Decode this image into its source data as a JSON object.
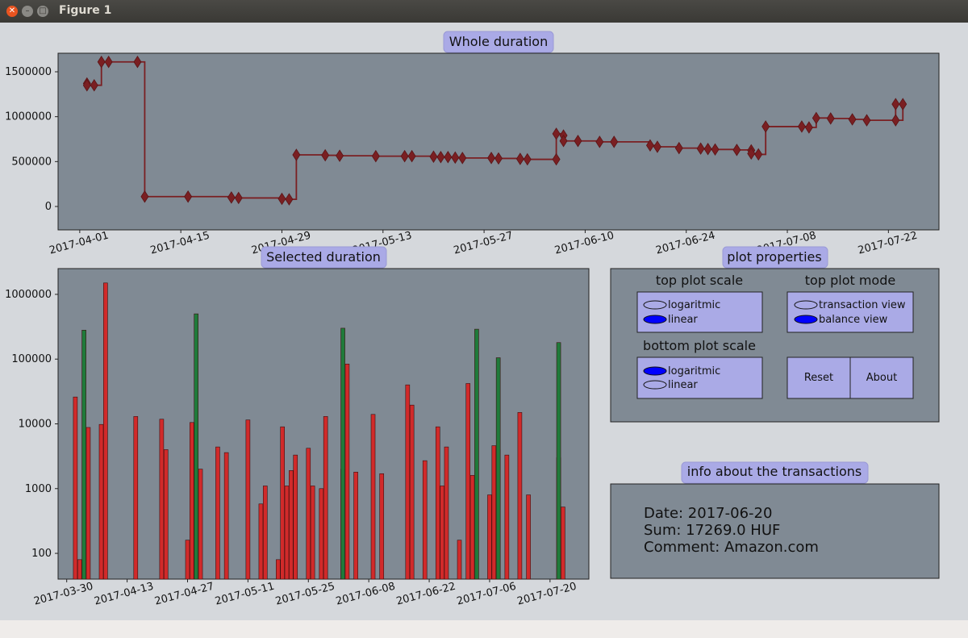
{
  "window": {
    "title": "Figure 1"
  },
  "top_chart": {
    "title": "Whole duration",
    "yticks": [
      0,
      500000,
      1000000,
      1500000
    ],
    "ytick_labels": [
      "0",
      "500000",
      "1000000",
      "1500000"
    ],
    "xtick_labels": [
      "2017-04-01",
      "2017-04-15",
      "2017-04-29",
      "2017-05-13",
      "2017-05-27",
      "2017-06-10",
      "2017-06-24",
      "2017-07-08",
      "2017-07-22"
    ]
  },
  "bottom_chart": {
    "title": "Selected duration",
    "ytick_labels": [
      "100",
      "1000",
      "10000",
      "100000",
      "1000000"
    ],
    "xtick_labels": [
      "2017-03-30",
      "2017-04-13",
      "2017-04-27",
      "2017-05-11",
      "2017-05-25",
      "2017-06-08",
      "2017-06-22",
      "2017-07-06",
      "2017-07-20"
    ]
  },
  "controls": {
    "title": "plot properties",
    "top_scale": {
      "label": "top plot scale",
      "options": [
        "logaritmic",
        "linear"
      ],
      "selected": "linear"
    },
    "top_mode": {
      "label": "top plot mode",
      "options": [
        "transaction view",
        "balance view"
      ],
      "selected": "balance view"
    },
    "bottom_scale": {
      "label": "bottom plot scale",
      "options": [
        "logaritmic",
        "linear"
      ],
      "selected": "logaritmic"
    },
    "reset_label": "Reset",
    "about_label": "About"
  },
  "info": {
    "title": "info about the transactions",
    "date_line": "Date: 2017-06-20",
    "sum_line": "Sum: 17269.0 HUF",
    "comment_line": "Comment: Amazon.com"
  },
  "colors": {
    "axes_bg": "#808a94",
    "line": "#7a1f22",
    "expense": "#d12a2a",
    "income": "#1f7a3a",
    "widget": "#aaaae6",
    "radio_on": "#0000ff"
  },
  "chart_data": [
    {
      "type": "line",
      "title": "Whole duration",
      "x_type": "date",
      "xlim": [
        "2017-03-29",
        "2017-07-29"
      ],
      "ylim": [
        0,
        1700000
      ],
      "grid": false,
      "marker": "diamond",
      "step": true,
      "points": [
        {
          "x": "2017-04-02",
          "y": 1370000
        },
        {
          "x": "2017-04-02",
          "y": 1350000
        },
        {
          "x": "2017-04-03",
          "y": 1350000
        },
        {
          "x": "2017-04-04",
          "y": 1610000
        },
        {
          "x": "2017-04-05",
          "y": 1610000
        },
        {
          "x": "2017-04-09",
          "y": 1610000
        },
        {
          "x": "2017-04-10",
          "y": 110000
        },
        {
          "x": "2017-04-16",
          "y": 110000
        },
        {
          "x": "2017-04-22",
          "y": 100000
        },
        {
          "x": "2017-04-23",
          "y": 95000
        },
        {
          "x": "2017-04-29",
          "y": 85000
        },
        {
          "x": "2017-04-30",
          "y": 80000
        },
        {
          "x": "2017-05-01",
          "y": 575000
        },
        {
          "x": "2017-05-05",
          "y": 570000
        },
        {
          "x": "2017-05-07",
          "y": 565000
        },
        {
          "x": "2017-05-12",
          "y": 560000
        },
        {
          "x": "2017-05-16",
          "y": 560000
        },
        {
          "x": "2017-05-17",
          "y": 560000
        },
        {
          "x": "2017-05-20",
          "y": 555000
        },
        {
          "x": "2017-05-21",
          "y": 550000
        },
        {
          "x": "2017-05-22",
          "y": 550000
        },
        {
          "x": "2017-05-23",
          "y": 545000
        },
        {
          "x": "2017-05-24",
          "y": 540000
        },
        {
          "x": "2017-05-28",
          "y": 540000
        },
        {
          "x": "2017-05-29",
          "y": 535000
        },
        {
          "x": "2017-06-01",
          "y": 530000
        },
        {
          "x": "2017-06-02",
          "y": 525000
        },
        {
          "x": "2017-06-06",
          "y": 525000
        },
        {
          "x": "2017-06-06",
          "y": 810000
        },
        {
          "x": "2017-06-07",
          "y": 790000
        },
        {
          "x": "2017-06-07",
          "y": 730000
        },
        {
          "x": "2017-06-09",
          "y": 730000
        },
        {
          "x": "2017-06-12",
          "y": 720000
        },
        {
          "x": "2017-06-14",
          "y": 720000
        },
        {
          "x": "2017-06-19",
          "y": 680000
        },
        {
          "x": "2017-06-20",
          "y": 665000
        },
        {
          "x": "2017-06-23",
          "y": 650000
        },
        {
          "x": "2017-06-26",
          "y": 645000
        },
        {
          "x": "2017-06-27",
          "y": 640000
        },
        {
          "x": "2017-06-28",
          "y": 635000
        },
        {
          "x": "2017-07-01",
          "y": 630000
        },
        {
          "x": "2017-07-03",
          "y": 625000
        },
        {
          "x": "2017-07-03",
          "y": 590000
        },
        {
          "x": "2017-07-04",
          "y": 580000
        },
        {
          "x": "2017-07-05",
          "y": 890000
        },
        {
          "x": "2017-07-10",
          "y": 890000
        },
        {
          "x": "2017-07-11",
          "y": 880000
        },
        {
          "x": "2017-07-12",
          "y": 985000
        },
        {
          "x": "2017-07-14",
          "y": 980000
        },
        {
          "x": "2017-07-17",
          "y": 970000
        },
        {
          "x": "2017-07-19",
          "y": 960000
        },
        {
          "x": "2017-07-23",
          "y": 1140000
        },
        {
          "x": "2017-07-23",
          "y": 960000
        },
        {
          "x": "2017-07-24",
          "y": 1140000
        }
      ]
    },
    {
      "type": "bar",
      "title": "Selected duration",
      "x_type": "date",
      "xlim": [
        "2017-03-28",
        "2017-07-29"
      ],
      "ylim": [
        40,
        2500000
      ],
      "yscale": "log",
      "grid": false,
      "series": [
        {
          "kind": "expense",
          "points": [
            {
              "x": "2017-04-01",
              "y": 26000
            },
            {
              "x": "2017-04-02",
              "y": 80
            },
            {
              "x": "2017-04-04",
              "y": 8800
            },
            {
              "x": "2017-04-07",
              "y": 9800
            },
            {
              "x": "2017-04-08",
              "y": 1500000
            },
            {
              "x": "2017-04-15",
              "y": 13000
            },
            {
              "x": "2017-04-21",
              "y": 11800
            },
            {
              "x": "2017-04-22",
              "y": 4000
            },
            {
              "x": "2017-04-27",
              "y": 160
            },
            {
              "x": "2017-04-28",
              "y": 10500
            },
            {
              "x": "2017-04-30",
              "y": 2000
            },
            {
              "x": "2017-05-04",
              "y": 4400
            },
            {
              "x": "2017-05-06",
              "y": 3600
            },
            {
              "x": "2017-05-11",
              "y": 11500
            },
            {
              "x": "2017-05-14",
              "y": 580
            },
            {
              "x": "2017-05-15",
              "y": 1100
            },
            {
              "x": "2017-05-18",
              "y": 80
            },
            {
              "x": "2017-05-19",
              "y": 9000
            },
            {
              "x": "2017-05-20",
              "y": 1100
            },
            {
              "x": "2017-05-21",
              "y": 1900
            },
            {
              "x": "2017-05-22",
              "y": 3300
            },
            {
              "x": "2017-05-25",
              "y": 4200
            },
            {
              "x": "2017-05-26",
              "y": 1100
            },
            {
              "x": "2017-05-28",
              "y": 1000
            },
            {
              "x": "2017-05-29",
              "y": 13000
            },
            {
              "x": "2017-06-02",
              "y": 2000
            },
            {
              "x": "2017-06-03",
              "y": 84000
            },
            {
              "x": "2017-06-05",
              "y": 1800
            },
            {
              "x": "2017-06-09",
              "y": 14000
            },
            {
              "x": "2017-06-11",
              "y": 1700
            },
            {
              "x": "2017-06-17",
              "y": 40000
            },
            {
              "x": "2017-06-18",
              "y": 19500
            },
            {
              "x": "2017-06-21",
              "y": 2700
            },
            {
              "x": "2017-06-24",
              "y": 9000
            },
            {
              "x": "2017-06-25",
              "y": 1100
            },
            {
              "x": "2017-06-26",
              "y": 4400
            },
            {
              "x": "2017-06-29",
              "y": 160
            },
            {
              "x": "2017-07-01",
              "y": 42000
            },
            {
              "x": "2017-07-02",
              "y": 1600
            },
            {
              "x": "2017-07-06",
              "y": 800
            },
            {
              "x": "2017-07-07",
              "y": 4600
            },
            {
              "x": "2017-07-08",
              "y": 4000
            },
            {
              "x": "2017-07-10",
              "y": 3300
            },
            {
              "x": "2017-07-13",
              "y": 15000
            },
            {
              "x": "2017-07-15",
              "y": 800
            },
            {
              "x": "2017-07-22",
              "y": 3000
            },
            {
              "x": "2017-07-23",
              "y": 520
            }
          ]
        },
        {
          "kind": "income",
          "points": [
            {
              "x": "2017-04-03",
              "y": 280000
            },
            {
              "x": "2017-04-29",
              "y": 500000
            },
            {
              "x": "2017-06-02",
              "y": 300000
            },
            {
              "x": "2017-07-03",
              "y": 290000
            },
            {
              "x": "2017-07-08",
              "y": 105000
            },
            {
              "x": "2017-07-22",
              "y": 180000
            }
          ]
        }
      ]
    }
  ]
}
